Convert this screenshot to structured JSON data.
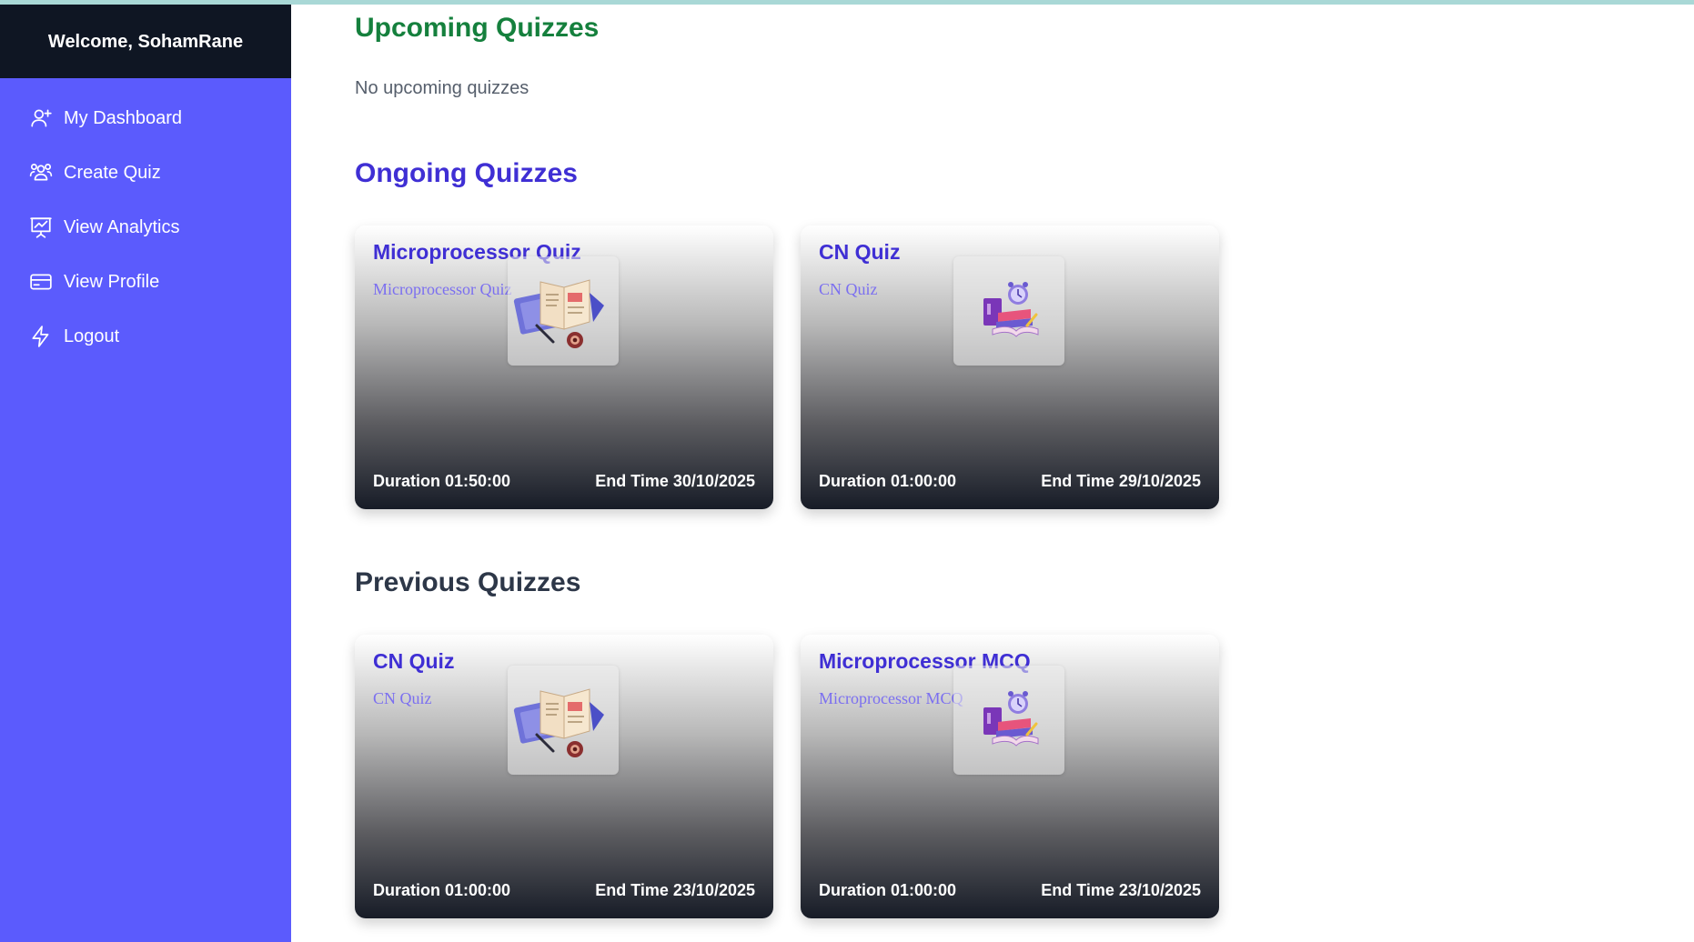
{
  "sidebar": {
    "welcome": "Welcome, SohamRane",
    "items": [
      {
        "label": "My Dashboard",
        "icon": "user-plus-icon"
      },
      {
        "label": "Create Quiz",
        "icon": "users-icon"
      },
      {
        "label": "View Analytics",
        "icon": "presentation-chart-icon"
      },
      {
        "label": "View Profile",
        "icon": "credit-card-icon"
      },
      {
        "label": "Logout",
        "icon": "bolt-icon"
      }
    ]
  },
  "sections": {
    "upcoming": {
      "title": "Upcoming Quizzes",
      "empty": "No upcoming quizzes"
    },
    "ongoing": {
      "title": "Ongoing Quizzes",
      "quizzes": [
        {
          "title": "Microprocessor Quiz",
          "subtitle": "Microprocessor Quiz",
          "duration": "Duration 01:50:00",
          "end_time": "End Time 30/10/2025",
          "image": "open-book-illustration"
        },
        {
          "title": "CN Quiz",
          "subtitle": "CN Quiz",
          "duration": "Duration 01:00:00",
          "end_time": "End Time 29/10/2025",
          "image": "books-clock-illustration"
        }
      ]
    },
    "previous": {
      "title": "Previous Quizzes",
      "quizzes": [
        {
          "title": "CN Quiz",
          "subtitle": "CN Quiz",
          "duration": "Duration 01:00:00",
          "end_time": "End Time 23/10/2025",
          "image": "open-book-illustration"
        },
        {
          "title": "Microprocessor MCQ",
          "subtitle": "Microprocessor MCQ",
          "duration": "Duration 01:00:00",
          "end_time": "End Time 23/10/2025",
          "image": "books-clock-illustration"
        }
      ]
    }
  },
  "colors": {
    "sidebar": "#5b5bfd",
    "sidebar_header": "#0f1623",
    "upcoming_title": "#15803d",
    "ongoing_title": "#3f2fd4",
    "previous_title": "#2d3748"
  }
}
